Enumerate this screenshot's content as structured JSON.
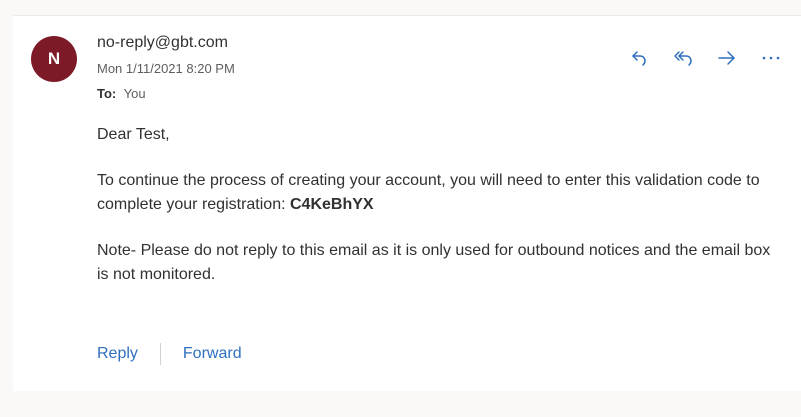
{
  "email": {
    "avatar_initial": "N",
    "sender": "no-reply@gbt.com",
    "datetime": "Mon 1/11/2021 8:20 PM",
    "to_label": "To:",
    "to_value": "You",
    "greeting": "Dear Test,",
    "paragraph1_text": "To continue the process of creating your account, you will need to enter this validation code to complete your registration: ",
    "validation_code": "C4KeBhYX",
    "paragraph2": "Note- Please do not reply to this email as it is only used for outbound notices and the email box is not monitored."
  },
  "toolbar": {
    "icons": [
      "reply-icon",
      "reply-all-icon",
      "forward-icon",
      "more-options-icon"
    ]
  },
  "footer": {
    "reply_label": "Reply",
    "forward_label": "Forward"
  },
  "colors": {
    "avatar_bg": "#7d1a27",
    "accent": "#2f6fbf",
    "page_bg": "#faf9f8"
  }
}
